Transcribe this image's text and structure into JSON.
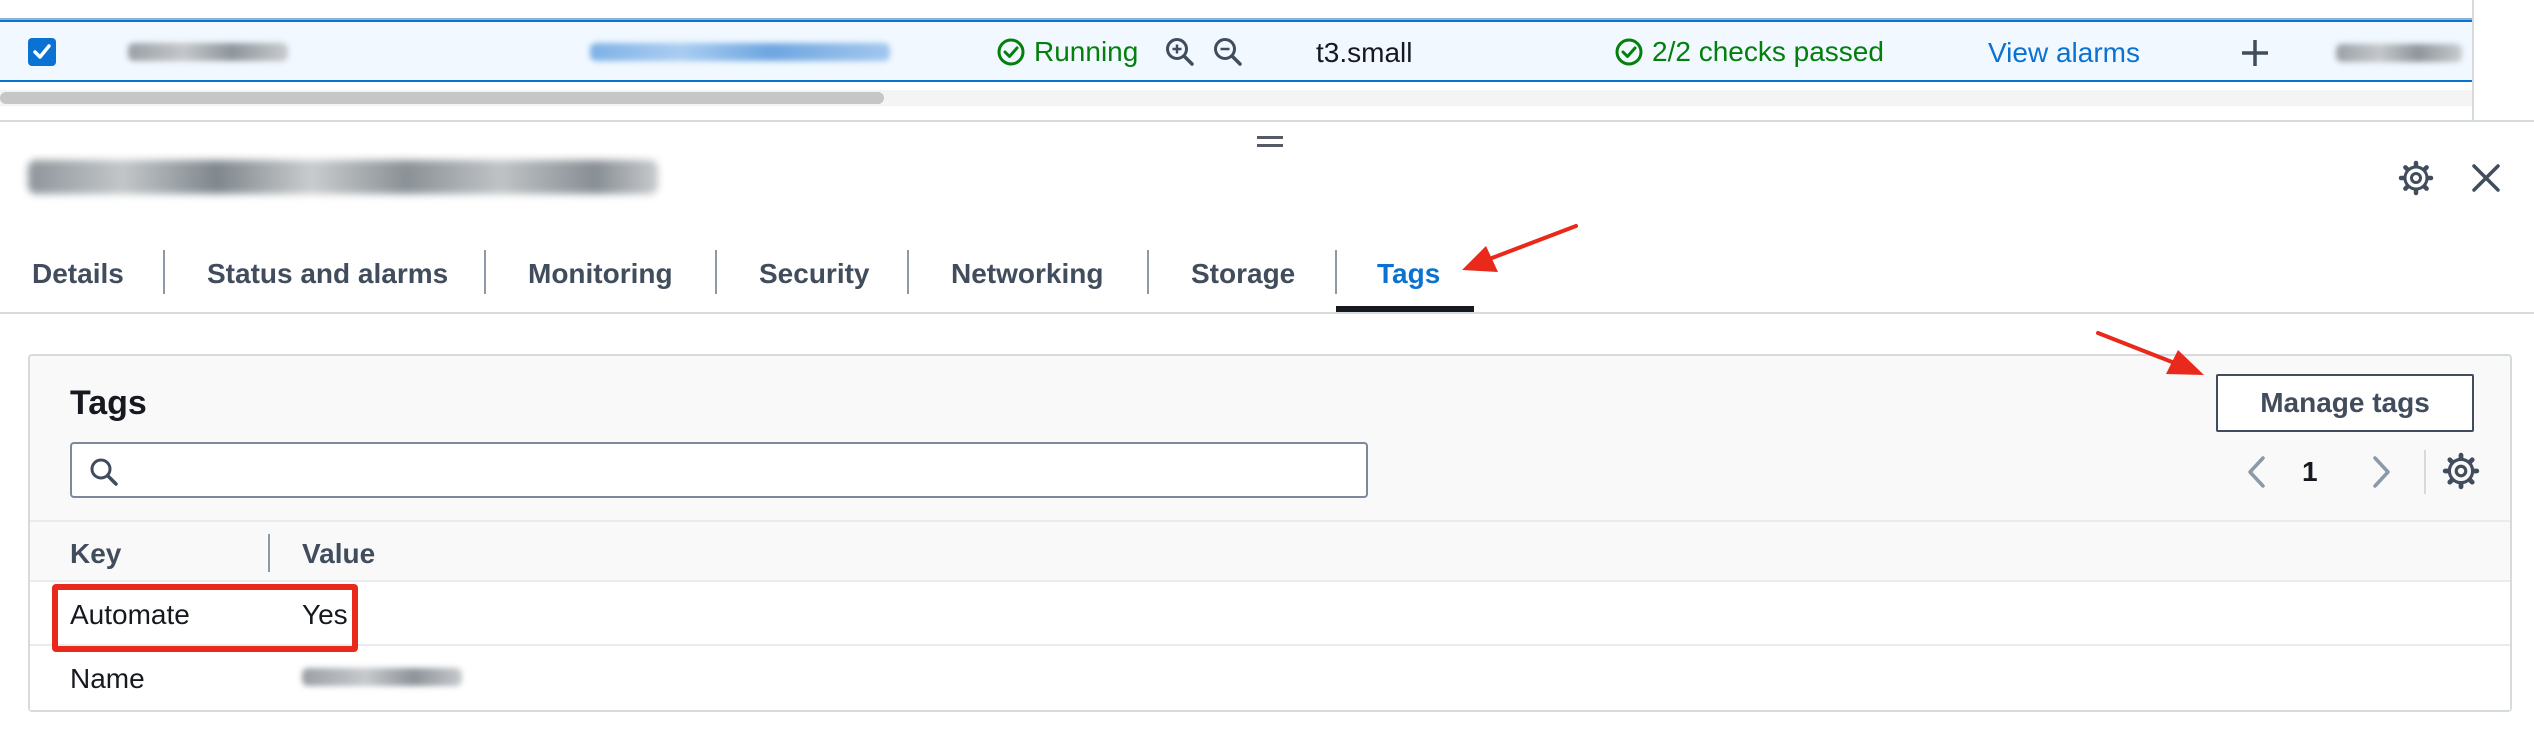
{
  "instance_row": {
    "status": "Running",
    "instance_type": "t3.small",
    "status_check": "2/2 checks passed",
    "alarm_link": "View alarms"
  },
  "tabs": [
    {
      "label": "Details"
    },
    {
      "label": "Status and alarms"
    },
    {
      "label": "Monitoring"
    },
    {
      "label": "Security"
    },
    {
      "label": "Networking"
    },
    {
      "label": "Storage"
    },
    {
      "label": "Tags"
    }
  ],
  "tags_panel": {
    "heading": "Tags",
    "manage_button": "Manage tags",
    "search": {
      "value": "",
      "placeholder": ""
    },
    "page_number": "1",
    "columns": {
      "key": "Key",
      "value": "Value"
    },
    "rows": [
      {
        "key": "Automate",
        "value": "Yes"
      },
      {
        "key": "Name",
        "value": ""
      }
    ]
  },
  "colors": {
    "accent": "#0972d3",
    "success": "#037f0c",
    "annotation": "#e8291b"
  },
  "icons": [
    "checkbox-checked-icon",
    "status-check-icon",
    "zoom-in-icon",
    "zoom-out-icon",
    "plus-icon",
    "drag-handle-icon",
    "settings-gear-icon",
    "close-icon",
    "search-icon",
    "chevron-left-icon",
    "chevron-right-icon"
  ]
}
